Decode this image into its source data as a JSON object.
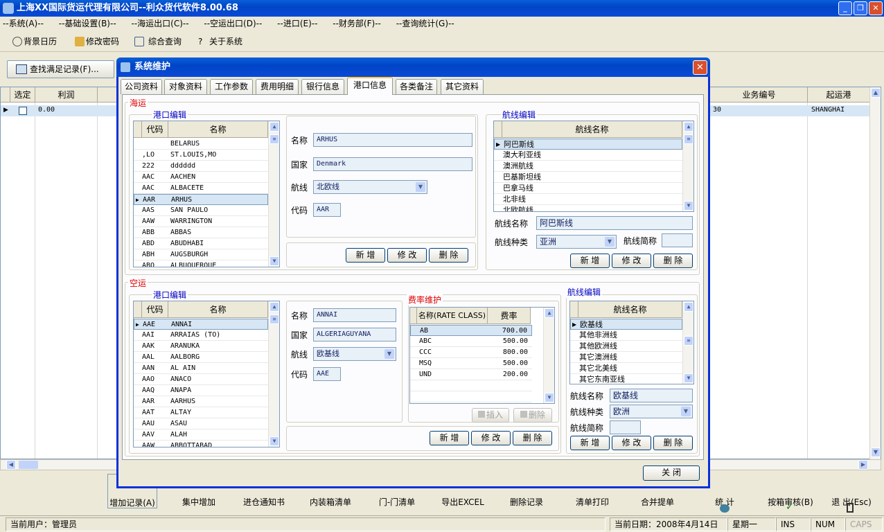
{
  "window": {
    "title": "上海XX国际货运代理有限公司--利众货代软件8.00.68"
  },
  "menu": [
    "--系统(A)--",
    "--基础设置(B)--",
    "--海运出口(C)--",
    "--空运出口(D)--",
    "--进口(E)--",
    "--财务部(F)--",
    "--查询统计(G)--"
  ],
  "toolbar": {
    "calendar": "背景日历",
    "password": "修改密码",
    "query": "综合查询",
    "about": "关于系统"
  },
  "search_button": "查找满足记录(F)...",
  "main_grid": {
    "headers": {
      "select": "选定",
      "profit": "利润",
      "bizno": "业务编号",
      "pol": "起运港"
    },
    "row": {
      "profit": "0.00",
      "bizno": "30",
      "pol": "SHANGHAI"
    }
  },
  "bottom_buttons": [
    "增加记录(A)",
    "集中增加",
    "进仓通知书",
    "内装箱清单",
    "门-门清单",
    "导出EXCEL",
    "删除记录",
    "清单打印",
    "合并提单",
    "统 计",
    "按箱审核(B)",
    "退 出(Esc)"
  ],
  "status": {
    "user": "当前用户：管理员",
    "date": "当前日期：2008年4月14日",
    "weekday": "星期一",
    "ins": "INS",
    "num": "NUM",
    "caps": "CAPS"
  },
  "dialog": {
    "title": "系统维护",
    "tabs": [
      "公司资料",
      "对象资料",
      "工作参数",
      "费用明细",
      "银行信息",
      "港口信息",
      "各类备注",
      "其它资料"
    ],
    "close": "关  闭",
    "sea": {
      "label": "海运",
      "port_group": "港口编辑",
      "route_group": "航线编辑",
      "col_code": "代码",
      "col_name": "名称",
      "col_route": "航线名称",
      "ports": [
        {
          "code": "",
          "name": "BELARUS"
        },
        {
          "code": ",LO",
          "name": "ST.LOUIS,MO"
        },
        {
          "code": "222",
          "name": "dddddd"
        },
        {
          "code": "AAC",
          "name": "AACHEN"
        },
        {
          "code": "AAC",
          "name": "ALBACETE"
        },
        {
          "code": "AAR",
          "name": "ARHUS"
        },
        {
          "code": "AAS",
          "name": "SAN PAULO"
        },
        {
          "code": "AAW",
          "name": "WARRINGTON"
        },
        {
          "code": "ABB",
          "name": "ABBAS"
        },
        {
          "code": "ABD",
          "name": "ABUDHABI"
        },
        {
          "code": "ABH",
          "name": "AUGSBURGH"
        },
        {
          "code": "ABQ",
          "name": "ALBUQUERQUE"
        }
      ],
      "form": {
        "name_label": "名称",
        "name": "ARHUS",
        "country_label": "国家",
        "country": "Denmark",
        "route_label": "航线",
        "route": "北欧线",
        "code_label": "代码",
        "code": "AAR"
      },
      "routes": [
        "阿巴斯线",
        "澳大利亚线",
        "澳洲航线",
        "巴基斯坦线",
        "巴拿马线",
        "北非线",
        "北欧航线"
      ],
      "route_form": {
        "name_label": "航线名称",
        "name": "阿巴斯线",
        "type_label": "航线种类",
        "type": "亚洲",
        "abbr_label": "航线简称",
        "abbr": ""
      },
      "btn_add": "新  增",
      "btn_edit": "修  改",
      "btn_del": "删  除"
    },
    "air": {
      "label": "空运",
      "port_group": "港口编辑",
      "rate_group": "费率维护",
      "route_group": "航线编辑",
      "col_code": "代码",
      "col_name": "名称",
      "col_route": "航线名称",
      "ports": [
        {
          "code": "AAE",
          "name": "ANNAI"
        },
        {
          "code": "AAI",
          "name": "ARRAIAS (TO)"
        },
        {
          "code": "AAK",
          "name": "ARANUKA"
        },
        {
          "code": "AAL",
          "name": "AALBORG"
        },
        {
          "code": "AAN",
          "name": "AL AIN"
        },
        {
          "code": "AAO",
          "name": "ANACO"
        },
        {
          "code": "AAQ",
          "name": "ANAPA"
        },
        {
          "code": "AAR",
          "name": "AARHUS"
        },
        {
          "code": "AAT",
          "name": "ALTAY"
        },
        {
          "code": "AAU",
          "name": "ASAU"
        },
        {
          "code": "AAV",
          "name": "ALAH"
        },
        {
          "code": "AAW",
          "name": "ABBOTTABAD"
        }
      ],
      "form": {
        "name_label": "名称",
        "name": "ANNAI",
        "country_label": "国家",
        "country": "ALGERIAGUYANA",
        "route_label": "航线",
        "route": "欧基线",
        "code_label": "代码",
        "code": "AAE"
      },
      "rates_header": {
        "name": "名称(RATE CLASS)",
        "rate": "费率"
      },
      "rates": [
        {
          "name": "AB",
          "rate": "700.00"
        },
        {
          "name": "ABC",
          "rate": "500.00"
        },
        {
          "name": "CCC",
          "rate": "800.00"
        },
        {
          "name": "MSQ",
          "rate": "500.00"
        },
        {
          "name": "UND",
          "rate": "200.00"
        }
      ],
      "rate_insert": "插入",
      "rate_delete": "删除",
      "routes": [
        "欧基线",
        "其他非洲线",
        "其他欧洲线",
        "其它澳洲线",
        "其它北美线",
        "其它东南亚线"
      ],
      "route_form": {
        "name_label": "航线名称",
        "name": "欧基线",
        "type_label": "航线种类",
        "type": "欧洲",
        "abbr_label": "航线简称",
        "abbr": ""
      },
      "btn_add": "新  增",
      "btn_edit": "修  改",
      "btn_del": "删  除"
    }
  }
}
